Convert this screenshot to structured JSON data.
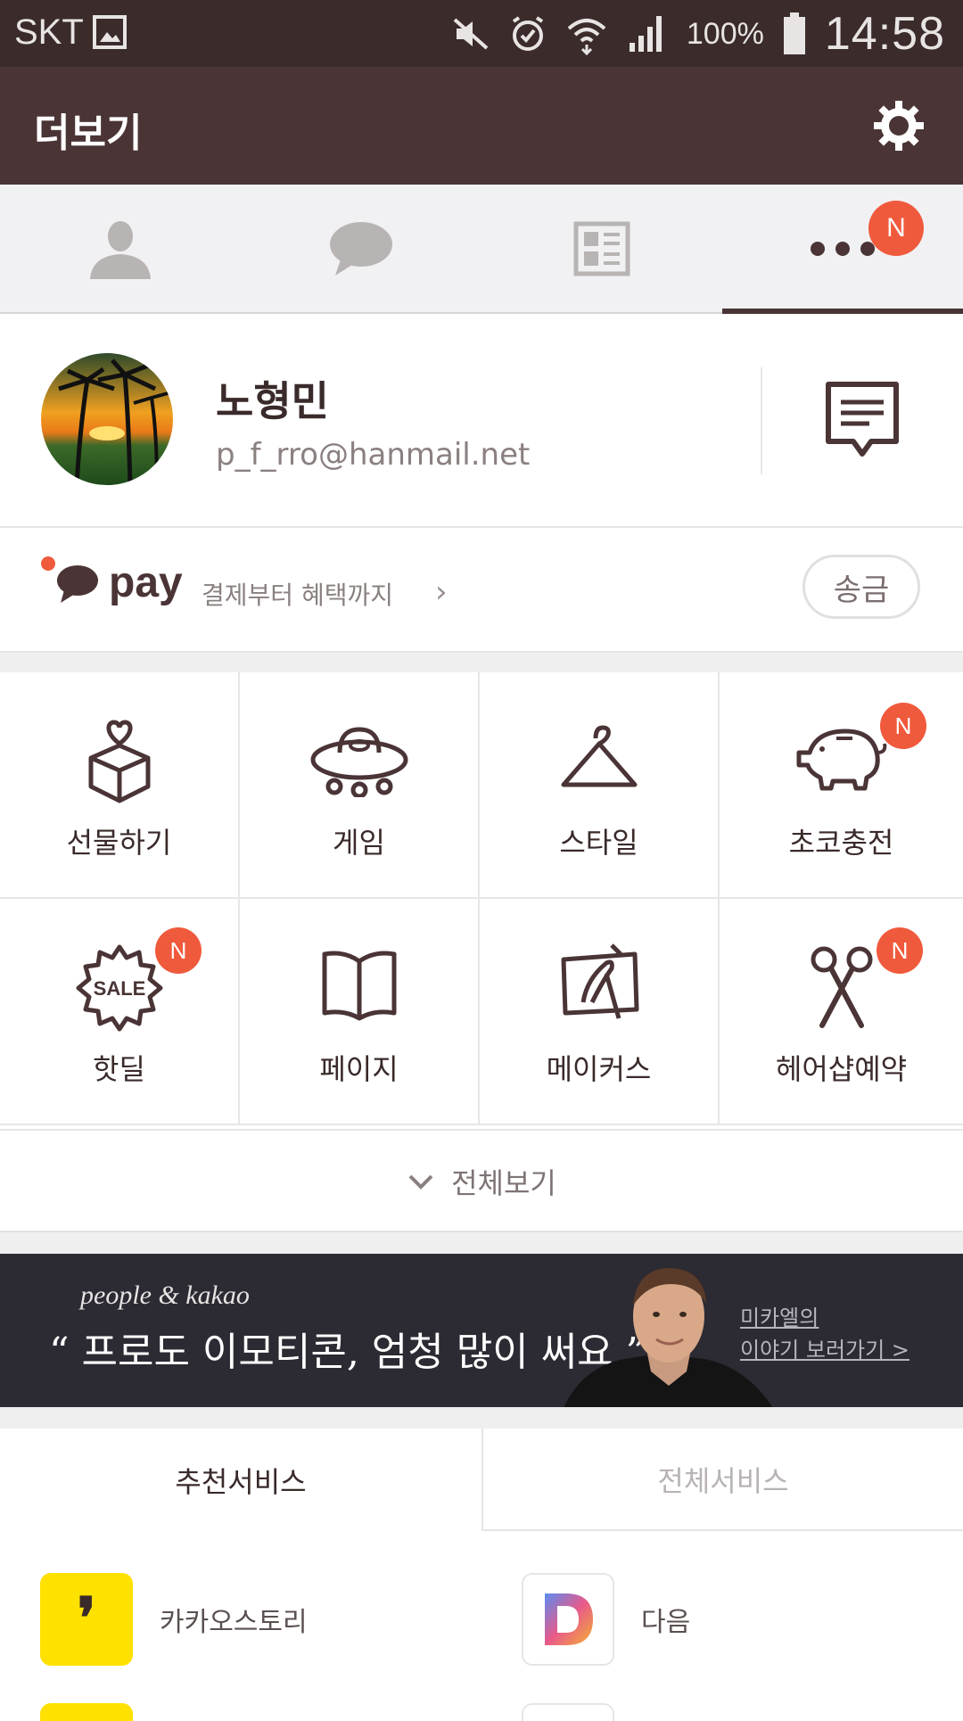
{
  "status_bar": {
    "carrier": "SKT",
    "battery_percent": "100%",
    "time": "14:58"
  },
  "title_bar": {
    "title": "더보기"
  },
  "tabs": {
    "more_badge": "N"
  },
  "profile": {
    "name": "노형민",
    "email": "p_f_rro@hanmail.net"
  },
  "pay": {
    "label": "pay",
    "subtitle": "결제부터 혜택까지",
    "chevron": "›",
    "send_button": "송금"
  },
  "grid": [
    {
      "label": "선물하기",
      "icon": "gift-box-icon",
      "badge": ""
    },
    {
      "label": "게임",
      "icon": "ufo-icon",
      "badge": ""
    },
    {
      "label": "스타일",
      "icon": "hanger-icon",
      "badge": ""
    },
    {
      "label": "초코충전",
      "icon": "piggy-bank-icon",
      "badge": "N"
    },
    {
      "label": "핫딜",
      "icon": "sale-badge-icon",
      "badge": "N",
      "icon_text": "SALE"
    },
    {
      "label": "페이지",
      "icon": "book-icon",
      "badge": ""
    },
    {
      "label": "메이커스",
      "icon": "makers-icon",
      "badge": ""
    },
    {
      "label": "헤어샵예약",
      "icon": "scissors-icon",
      "badge": "N"
    }
  ],
  "view_all": {
    "label": "전체보기"
  },
  "banner": {
    "brand": "people & kakao",
    "quote": "“ 프로도 이모티콘, 엄청 많이 써요 ”",
    "link_line1": "미카엘의",
    "link_line2": "이야기 보러가기 >"
  },
  "service_tabs": {
    "recommended": "추천서비스",
    "all": "전체서비스"
  },
  "services": [
    {
      "name": "카카오스토리",
      "icon": "kakaostory-icon",
      "icon_glyph": "❜",
      "color": "#ffe100"
    },
    {
      "name": "다음",
      "icon": "daum-icon",
      "icon_glyph": "D",
      "color": "#ffffff"
    }
  ],
  "colors": {
    "brand_brown": "#4a3435",
    "badge_red": "#f05a3c",
    "status_bar": "#3b2b2b"
  }
}
